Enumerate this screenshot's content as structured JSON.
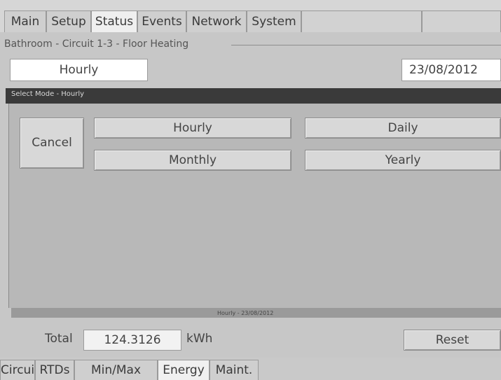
{
  "top_tabs": [
    {
      "label": "Main"
    },
    {
      "label": "Setup"
    },
    {
      "label": "Status"
    },
    {
      "label": "Events"
    },
    {
      "label": "Network"
    },
    {
      "label": "System"
    }
  ],
  "active_top_tab": "Status",
  "circuit_title": "Bathroom - Circuit 1-3 - Floor Heating",
  "mode_display": "Hourly",
  "date_display": "23/08/2012",
  "dialog": {
    "title": "Select Mode - Hourly",
    "cancel_label": "Cancel",
    "options": [
      "Hourly",
      "Daily",
      "Monthly",
      "Yearly"
    ]
  },
  "scroll_caption": "Hourly - 23/08/2012",
  "totals": {
    "label": "Total",
    "value": "124.3126",
    "unit": "kWh",
    "reset_label": "Reset"
  },
  "bottom_tabs": [
    {
      "label": "Circuit"
    },
    {
      "label": "RTDs"
    },
    {
      "label": "Min/Max"
    },
    {
      "label": "Energy"
    },
    {
      "label": "Maint."
    }
  ],
  "active_bottom_tab": "Energy"
}
